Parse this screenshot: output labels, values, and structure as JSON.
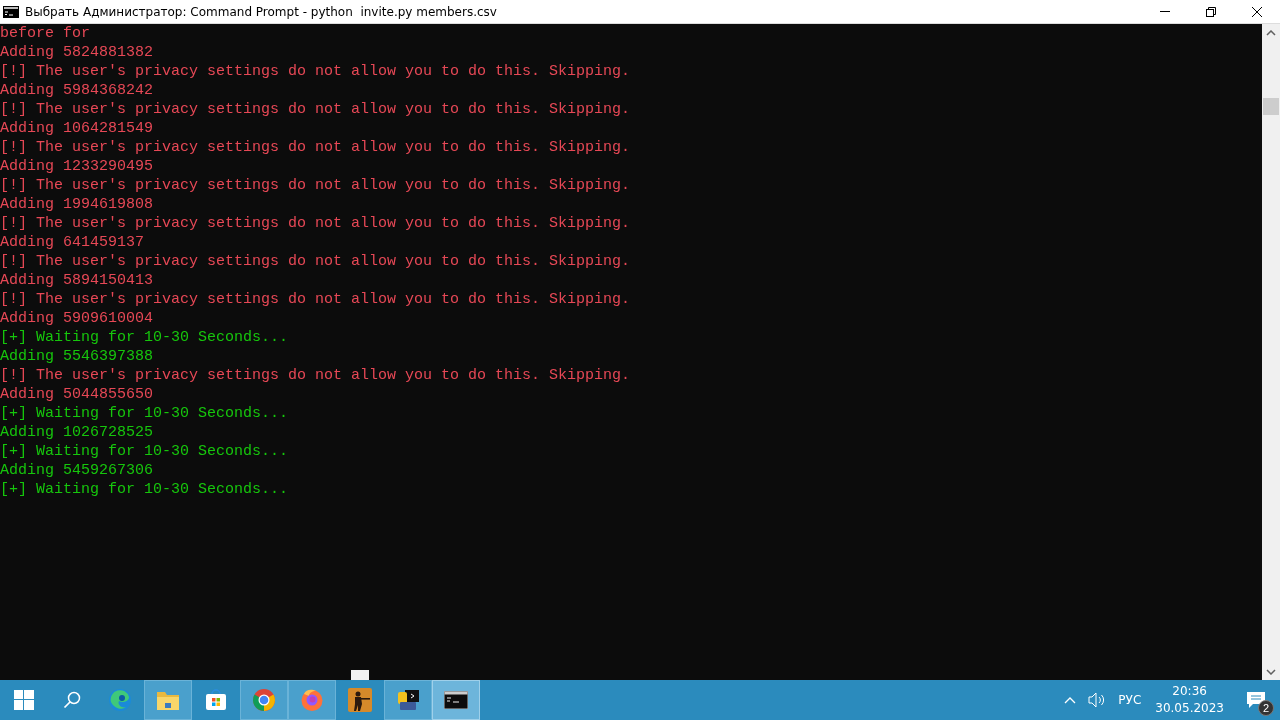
{
  "window": {
    "title": "Выбрать Администратор: Command Prompt - python  invite.py members.csv"
  },
  "console": {
    "lines": [
      {
        "text": "before for",
        "color": "#e74856"
      },
      {
        "text": "Adding 5824881382",
        "color": "#e74856"
      },
      {
        "text": "[!] The user's privacy settings do not allow you to do this. Skipping.",
        "color": "#e74856"
      },
      {
        "text": "Adding 5984368242",
        "color": "#e74856"
      },
      {
        "text": "[!] The user's privacy settings do not allow you to do this. Skipping.",
        "color": "#e74856"
      },
      {
        "text": "Adding 1064281549",
        "color": "#e74856"
      },
      {
        "text": "[!] The user's privacy settings do not allow you to do this. Skipping.",
        "color": "#e74856"
      },
      {
        "text": "Adding 1233290495",
        "color": "#e74856"
      },
      {
        "text": "[!] The user's privacy settings do not allow you to do this. Skipping.",
        "color": "#e74856"
      },
      {
        "text": "Adding 1994619808",
        "color": "#e74856"
      },
      {
        "text": "[!] The user's privacy settings do not allow you to do this. Skipping.",
        "color": "#e74856"
      },
      {
        "text": "Adding 641459137",
        "color": "#e74856"
      },
      {
        "text": "[!] The user's privacy settings do not allow you to do this. Skipping.",
        "color": "#e74856"
      },
      {
        "text": "Adding 5894150413",
        "color": "#e74856"
      },
      {
        "text": "[!] The user's privacy settings do not allow you to do this. Skipping.",
        "color": "#e74856"
      },
      {
        "text": "Adding 5909610004",
        "color": "#e74856"
      },
      {
        "text": "[+] Waiting for 10-30 Seconds...",
        "color": "#16c60c"
      },
      {
        "text": "Adding 5546397388",
        "color": "#16c60c"
      },
      {
        "text": "[!] The user's privacy settings do not allow you to do this. Skipping.",
        "color": "#e74856"
      },
      {
        "text": "Adding 5044855650",
        "color": "#e74856"
      },
      {
        "text": "[+] Waiting for 10-30 Seconds...",
        "color": "#16c60c"
      },
      {
        "text": "Adding 1026728525",
        "color": "#16c60c"
      },
      {
        "text": "[+] Waiting for 10-30 Seconds...",
        "color": "#16c60c"
      },
      {
        "text": "Adding 5459267306",
        "color": "#16c60c"
      },
      {
        "text": "[+] Waiting for 10-30 Seconds...",
        "color": "#16c60c"
      }
    ]
  },
  "taskbar": {
    "apps": [
      {
        "kind": "start",
        "running": false,
        "selected": false
      },
      {
        "kind": "search",
        "running": false,
        "selected": false
      },
      {
        "kind": "edge",
        "running": false,
        "selected": false
      },
      {
        "kind": "folder",
        "running": true,
        "selected": false
      },
      {
        "kind": "store",
        "running": false,
        "selected": false
      },
      {
        "kind": "chrome",
        "running": true,
        "selected": false
      },
      {
        "kind": "firefox",
        "running": true,
        "selected": false
      },
      {
        "kind": "game",
        "running": false,
        "selected": false
      },
      {
        "kind": "python",
        "running": true,
        "selected": false
      },
      {
        "kind": "terminal",
        "running": true,
        "selected": true
      }
    ],
    "language": "РУС",
    "time": "20:36",
    "date": "30.05.2023",
    "notification_count": "2"
  }
}
